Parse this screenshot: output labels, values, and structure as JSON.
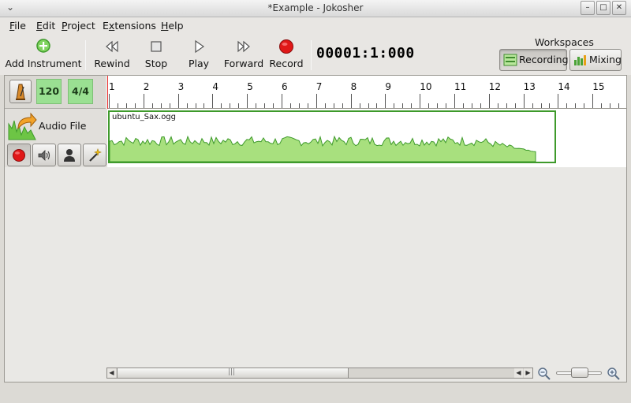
{
  "window": {
    "title": "*Example - Jokosher",
    "menu_glyph": "⌄",
    "controls": {
      "minimize": "–",
      "maximize": "□",
      "close": "✕"
    }
  },
  "menu": {
    "items": [
      {
        "label": "File",
        "accel": "F",
        "rest": "ile"
      },
      {
        "label": "Edit",
        "accel": "E",
        "rest": "dit"
      },
      {
        "label": "Project",
        "accel": "P",
        "rest": "roject"
      },
      {
        "label": "Extensions",
        "pre": "E",
        "accel": "x",
        "rest": "tensions"
      },
      {
        "label": "Help",
        "accel": "H",
        "rest": "elp"
      }
    ]
  },
  "toolbar": {
    "add_instrument": "Add Instrument",
    "rewind": "Rewind",
    "stop": "Stop",
    "play": "Play",
    "forward": "Forward",
    "record": "Record",
    "timecode": "00001:1:000"
  },
  "workspaces": {
    "label": "Workspaces",
    "recording": "Recording",
    "mixing": "Mixing",
    "active": "Recording"
  },
  "project": {
    "tempo": "120",
    "time_signature": "4/4",
    "ruler_bars": [
      "1",
      "2",
      "3",
      "4",
      "5",
      "6",
      "7",
      "8",
      "9",
      "10",
      "11",
      "12",
      "13",
      "14",
      "15"
    ]
  },
  "instrument": {
    "name": "Audio File",
    "event_file": "ubuntu_Sax.ogg"
  },
  "colors": {
    "wave_fill": "#a8e07e",
    "wave_stroke": "#3e9a2b",
    "record_red": "#e01818",
    "tempo_bg": "#9ae092"
  },
  "icons": {
    "add_instrument": "add-circle-icon",
    "rewind": "rewind-icon",
    "stop": "stop-icon",
    "play": "play-icon",
    "forward": "forward-icon",
    "record": "record-icon",
    "metronome": "metronome-icon",
    "instrument": "audio-file-instrument-icon",
    "arm": "record-arm-icon",
    "mute": "speaker-icon",
    "solo": "person-icon",
    "effects": "effects-wand-icon",
    "zoom_out": "zoom-out-icon",
    "zoom_in": "zoom-in-icon",
    "hscroll_grip": "|||"
  }
}
